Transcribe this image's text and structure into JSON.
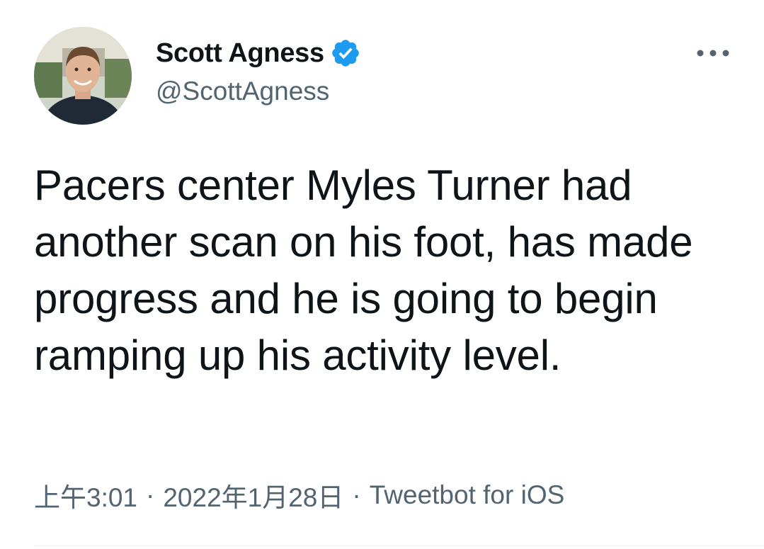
{
  "author": {
    "display_name": "Scott Agness",
    "handle": "@ScottAgness",
    "verified": true
  },
  "tweet": {
    "text": "Pacers center Myles Turner had another scan on his foot, has made progress and he is going to begin ramping up his activity level.",
    "time": "上午3:01",
    "separator": "·",
    "date": "2022年1月28日",
    "source": "Tweetbot for iOS"
  },
  "icons": {
    "verified": "verified-badge-icon",
    "more": "more-options-icon"
  },
  "colors": {
    "verified_blue": "#1d9bf0",
    "text_primary": "#0f1419",
    "text_secondary": "#536471"
  }
}
